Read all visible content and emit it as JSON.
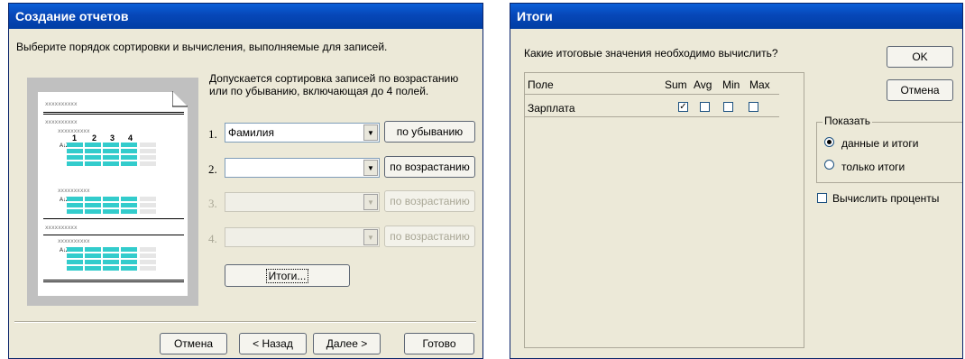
{
  "left_window": {
    "title": "Создание отчетов",
    "instruction": "Выберите порядок сортировки и вычисления, выполняемые для записей.",
    "description": "Допускается сортировка записей по возрастанию или по убыванию, включающая до 4 полей.",
    "preview": {
      "placeholder": "xxxxxxxxxx",
      "column_numbers": [
        "1",
        "2",
        "3",
        "4"
      ],
      "sort_glyph": "A↓Z"
    },
    "sort_rows": [
      {
        "num": "1.",
        "field": "Фамилия",
        "order": "по убыванию",
        "enabled": true
      },
      {
        "num": "2.",
        "field": "",
        "order": "по возрастанию",
        "enabled": true
      },
      {
        "num": "3.",
        "field": "",
        "order": "по возрастанию",
        "enabled": false
      },
      {
        "num": "4.",
        "field": "",
        "order": "по возрастанию",
        "enabled": false
      }
    ],
    "totals_button": "Итоги...",
    "buttons": {
      "cancel": "Отмена",
      "back": "< Назад",
      "next": "Далее >",
      "finish": "Готово"
    }
  },
  "right_window": {
    "title": "Итоги",
    "question": "Какие итоговые значения необходимо вычислить?",
    "columns": {
      "field": "Поле",
      "sum": "Sum",
      "avg": "Avg",
      "min": "Min",
      "max": "Max"
    },
    "rows": [
      {
        "field": "Зарплата",
        "sum": true,
        "avg": false,
        "min": false,
        "max": false
      }
    ],
    "ok": "OK",
    "cancel": "Отмена",
    "show_group": {
      "label": "Показать",
      "options": [
        {
          "label": "данные и итоги",
          "selected": true
        },
        {
          "label": "только итоги",
          "selected": false
        }
      ]
    },
    "percent_checkbox": {
      "label": "Вычислить проценты",
      "checked": false
    }
  }
}
